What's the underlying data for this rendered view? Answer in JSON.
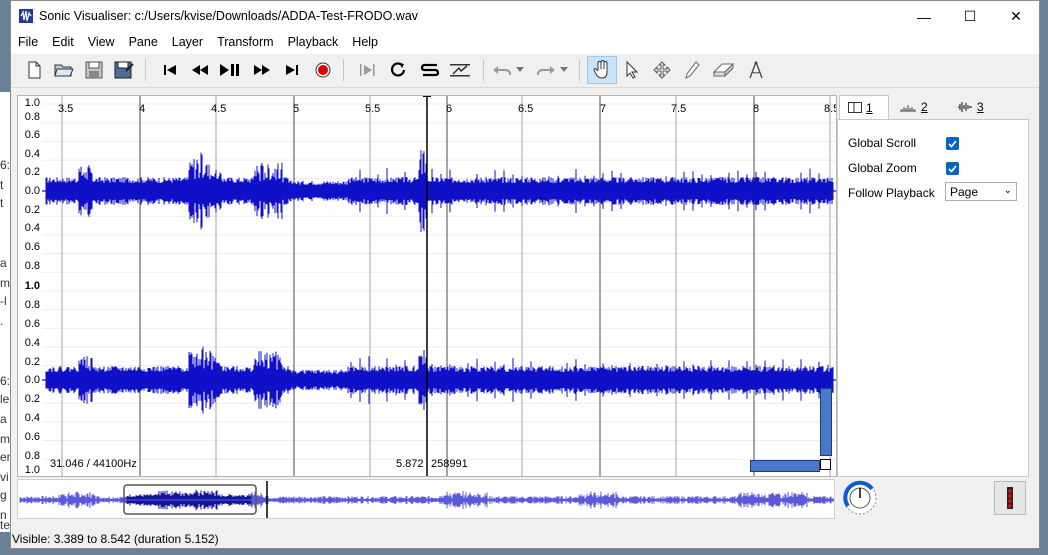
{
  "background_window": {
    "fragments": [
      "6:",
      "t",
      "t",
      "a",
      "m",
      "-l",
      ".",
      "6:",
      "le",
      "a",
      "m",
      "en",
      "vi",
      "g",
      "n",
      "te"
    ]
  },
  "window": {
    "title": "Sonic Visualiser: c:/Users/kvise/Downloads/ADDA-Test-FRODO.wav",
    "controls": {
      "minimize": "—",
      "maximize": "☐",
      "close": "✕"
    }
  },
  "menu": [
    {
      "key": "file",
      "label": "File"
    },
    {
      "key": "edit",
      "label": "Edit"
    },
    {
      "key": "view",
      "label": "View"
    },
    {
      "key": "pane",
      "label": "Pane"
    },
    {
      "key": "layer",
      "label": "Layer"
    },
    {
      "key": "transform",
      "label": "Transform"
    },
    {
      "key": "playback",
      "label": "Playback"
    },
    {
      "key": "help",
      "label": "Help"
    }
  ],
  "toolbar": {
    "icons": [
      "new-file-icon",
      "open-file-icon",
      "save-icon",
      "save-as-icon",
      "rewind-start-icon",
      "rewind-icon",
      "play-pause-icon",
      "fast-forward-icon",
      "fast-forward-end-icon",
      "record-icon",
      "play-selection-icon",
      "loop-icon",
      "solo-icon",
      "normalize-icon",
      "undo-icon",
      "redo-icon",
      "navigate-hand-icon",
      "select-arrow-icon",
      "move-icon",
      "draw-pencil-icon",
      "erase-icon",
      "measure-icon"
    ],
    "active_tool": "navigate-hand-icon"
  },
  "pane": {
    "time_ruler": [
      "3.5",
      "4",
      "4.5",
      "5",
      "5.5",
      "6",
      "6.5",
      "7",
      "7.5",
      "8",
      "8.5"
    ],
    "amplitude_scale_top": [
      "1.0",
      "0.8",
      "0.6",
      "0.4",
      "0.2",
      "0.0",
      "0.2",
      "0.4",
      "0.6",
      "0.8"
    ],
    "amplitude_scale_bottom": [
      "1.0",
      "0.8",
      "0.6",
      "0.4",
      "0.2",
      "0.0",
      "0.2",
      "0.4",
      "0.6",
      "0.8",
      "1.0"
    ],
    "rate_info": "31.046 / 44100Hz",
    "cursor_time": "5.872",
    "cursor_frame": "258991",
    "waveform_color": "#1010c8"
  },
  "properties": {
    "tabs": [
      {
        "label": "1",
        "icon": "pane-icon"
      },
      {
        "label": "2",
        "icon": "spectrum-icon"
      },
      {
        "label": "3",
        "icon": "waveform-icon"
      }
    ],
    "selected_tab": "1",
    "global_scroll_label": "Global Scroll",
    "global_scroll_checked": true,
    "global_zoom_label": "Global Zoom",
    "global_zoom_checked": true,
    "follow_playback_label": "Follow Playback",
    "follow_playback_value": "Page",
    "accent_color": "#0067c0"
  },
  "overview": {
    "waveform_color": "#5a5ad8",
    "viewport_color": "#14149a"
  },
  "status": {
    "text": "Visible: 3.389 to 8.542 (duration 5.152)"
  }
}
